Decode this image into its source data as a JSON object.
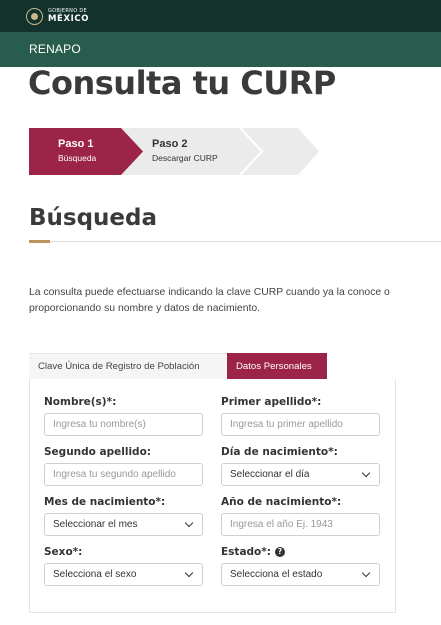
{
  "header": {
    "logo_line1": "GOBIERNO DE",
    "logo_line2": "MÉXICO",
    "brand": "RENAPO"
  },
  "page": {
    "title": "Consulta tu CURP"
  },
  "steps": [
    {
      "title": "Paso 1",
      "subtitle": "Búsqueda",
      "active": true
    },
    {
      "title": "Paso 2",
      "subtitle": "Descargar CURP",
      "active": false
    }
  ],
  "section": {
    "title": "Búsqueda",
    "intro": "La consulta puede efectuarse indicando la clave CURP cuando ya la conoce o proporcionando su nombre y datos de nacimiento."
  },
  "tabs": {
    "curp_label": "Clave Única de Registro de Población",
    "datos_label": "Datos Personales",
    "active": "Datos Personales"
  },
  "form": {
    "nombre": {
      "label": "Nombre(s)*:",
      "placeholder": "Ingresa tu nombre(s)"
    },
    "primer_apellido": {
      "label": "Primer apellido*:",
      "placeholder": "Ingresa tu primer apellido"
    },
    "segundo_apellido": {
      "label": "Segundo apellido:",
      "placeholder": "Ingresa tu segundo apellido"
    },
    "dia": {
      "label": "Día de nacimiento*:",
      "value": "Seleccionar el día"
    },
    "mes": {
      "label": "Mes de nacimiento*:",
      "value": "Seleccionar el mes"
    },
    "anio": {
      "label": "Año de nacimiento*:",
      "placeholder": "Ingresa el año Ej. 1943"
    },
    "sexo": {
      "label": "Sexo*:",
      "value": "Selecciona el sexo"
    },
    "estado": {
      "label": "Estado*:",
      "value": "Selecciona el estado",
      "help_icon": "question-circle-icon"
    }
  },
  "colors": {
    "topbar": "#13322b",
    "subbar": "#285c4d",
    "accent_red": "#9d2449",
    "accent_gold": "#bc955c",
    "step_inactive": "#f0f0f0"
  }
}
